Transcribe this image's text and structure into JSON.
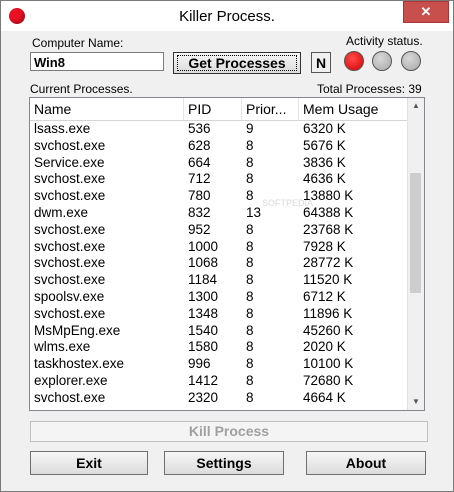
{
  "window": {
    "title": "Killer Process.",
    "close_glyph": "✕"
  },
  "computer": {
    "label": "Computer Name:",
    "value": "Win8"
  },
  "buttons": {
    "get_processes": "Get Processes",
    "n_indicator": "N",
    "kill": "Kill Process",
    "exit": "Exit",
    "settings": "Settings",
    "about": "About"
  },
  "activity": {
    "label": "Activity status.",
    "lights": [
      "red",
      "gray",
      "gray"
    ],
    "colors": {
      "red": "#e00000",
      "gray": "#c0c0c0"
    }
  },
  "processes": {
    "label": "Current Processes.",
    "total_label": "Total Processes: 39",
    "watermark": "SOFTPEDIA",
    "columns": [
      "Name",
      "PID",
      "Prior...",
      "Mem Usage"
    ],
    "rows": [
      [
        "lsass.exe",
        "536",
        "9",
        "6320 K"
      ],
      [
        "svchost.exe",
        "628",
        "8",
        "5676 K"
      ],
      [
        "Service.exe",
        "664",
        "8",
        "3836 K"
      ],
      [
        "svchost.exe",
        "712",
        "8",
        "4636 K"
      ],
      [
        "svchost.exe",
        "780",
        "8",
        "13880 K"
      ],
      [
        "dwm.exe",
        "832",
        "13",
        "64388 K"
      ],
      [
        "svchost.exe",
        "952",
        "8",
        "23768 K"
      ],
      [
        "svchost.exe",
        "1000",
        "8",
        "7928 K"
      ],
      [
        "svchost.exe",
        "1068",
        "8",
        "28772 K"
      ],
      [
        "svchost.exe",
        "1184",
        "8",
        "11520 K"
      ],
      [
        "spoolsv.exe",
        "1300",
        "8",
        "6712 K"
      ],
      [
        "svchost.exe",
        "1348",
        "8",
        "11896 K"
      ],
      [
        "MsMpEng.exe",
        "1540",
        "8",
        "45260 K"
      ],
      [
        "wlms.exe",
        "1580",
        "8",
        "2020 K"
      ],
      [
        "taskhostex.exe",
        "996",
        "8",
        "10100 K"
      ],
      [
        "explorer.exe",
        "1412",
        "8",
        "72680 K"
      ],
      [
        "svchost.exe",
        "2320",
        "8",
        "4664 K"
      ]
    ]
  },
  "icons": {
    "app": "red-circle-icon",
    "scroll_up": "▲",
    "scroll_down": "▼"
  }
}
